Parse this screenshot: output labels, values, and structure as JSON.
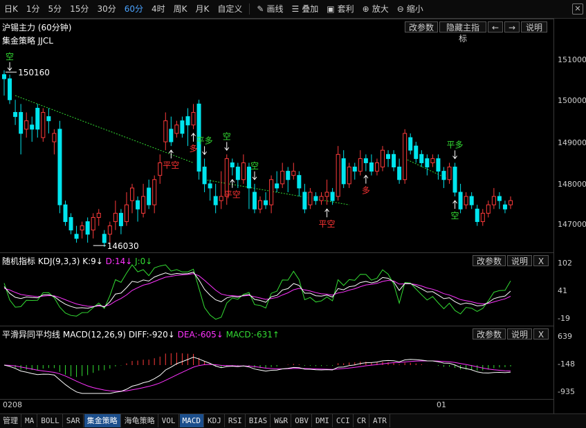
{
  "toolbar": {
    "periods": [
      {
        "label": "日K",
        "active": false
      },
      {
        "label": "1分",
        "active": false
      },
      {
        "label": "5分",
        "active": false
      },
      {
        "label": "15分",
        "active": false
      },
      {
        "label": "30分",
        "active": false
      },
      {
        "label": "60分",
        "active": true
      },
      {
        "label": "4时",
        "active": false
      },
      {
        "label": "周K",
        "active": false
      },
      {
        "label": "月K",
        "active": false
      },
      {
        "label": "自定义",
        "active": false
      }
    ],
    "tools": {
      "draw": "画线",
      "overlay": "叠加",
      "arbitrage": "套利",
      "zoom_in": "放大",
      "zoom_out": "缩小"
    }
  },
  "main": {
    "title": "沪锡主力 (60分钟)",
    "strategy": "集金策略 JJCL",
    "buttons": {
      "params": "改参数",
      "hide": "隐藏主指标",
      "prev": "←",
      "next": "→",
      "help": "说明"
    },
    "y_labels": [
      "151000",
      "150000",
      "149000",
      "148000",
      "147000"
    ],
    "high_label": "150160",
    "low_label": "146030",
    "signals": [
      {
        "text": "空",
        "type": "sell"
      },
      {
        "text": "平多",
        "type": "sell"
      },
      {
        "text": "多",
        "type": "buy"
      },
      {
        "text": "空",
        "type": "sell"
      },
      {
        "text": "空",
        "type": "sell"
      },
      {
        "text": "平空",
        "type": "buy"
      },
      {
        "text": "平空",
        "type": "buy"
      },
      {
        "text": "多",
        "type": "buy"
      },
      {
        "text": "平空",
        "type": "buy"
      },
      {
        "text": "平多",
        "type": "sell"
      },
      {
        "text": "空",
        "type": "sell"
      }
    ]
  },
  "kdj": {
    "name": "随机指标",
    "params": "KDJ(9,3,3)",
    "k": "K:9↓",
    "d": "D:14↓",
    "j": "J:0↓",
    "buttons": {
      "params": "改参数",
      "help": "说明",
      "close": "X"
    },
    "y_labels": [
      "102",
      "41",
      "-19"
    ]
  },
  "macd": {
    "name": "平滑异同平均线",
    "params": "MACD(12,26,9)",
    "diff": "DIFF:-920↓",
    "dea": "DEA:-605↓",
    "macd": "MACD:-631↑",
    "buttons": {
      "params": "改参数",
      "help": "说明",
      "close": "X"
    },
    "y_labels": [
      "639",
      "-148",
      "-935"
    ]
  },
  "time_axis": {
    "start": "0208",
    "mid": "01"
  },
  "bottom_tabs": [
    {
      "label": "管理",
      "active": false
    },
    {
      "label": "MA",
      "active": false
    },
    {
      "label": "BOLL",
      "active": false
    },
    {
      "label": "SAR",
      "active": false
    },
    {
      "label": "集金策略",
      "active": true
    },
    {
      "label": "海龟策略",
      "active": false
    },
    {
      "label": "VOL",
      "active": false
    },
    {
      "label": "MACD",
      "active": true
    },
    {
      "label": "KDJ",
      "active": false
    },
    {
      "label": "RSI",
      "active": false
    },
    {
      "label": "BIAS",
      "active": false
    },
    {
      "label": "W&R",
      "active": false
    },
    {
      "label": "OBV",
      "active": false
    },
    {
      "label": "DMI",
      "active": false
    },
    {
      "label": "CCI",
      "active": false
    },
    {
      "label": "CR",
      "active": false
    },
    {
      "label": "ATR",
      "active": false
    }
  ],
  "colors": {
    "up": "#ff3b3b",
    "down": "#00e5ee",
    "k": "#ffffff",
    "d": "#ff33ff",
    "j": "#33dd33",
    "accent": "#4aa3ff",
    "signal_text_sell": "#33dd33",
    "signal_text_buy": "#ff3333"
  },
  "chart_data": {
    "type": "candlestick",
    "title": "沪锡主力 (60分钟)",
    "ylim": [
      146000,
      151200
    ],
    "candles": [
      [
        150100,
        150000,
        149600,
        150200
      ],
      [
        150000,
        149500,
        149400,
        150100
      ],
      [
        149200,
        149100,
        148900,
        149500
      ],
      [
        149200,
        148700,
        148200,
        149400
      ],
      [
        148800,
        149000,
        148600,
        149200
      ],
      [
        148900,
        148800,
        148500,
        149100
      ],
      [
        149300,
        148800,
        148600,
        149400
      ],
      [
        148600,
        149200,
        148500,
        149300
      ],
      [
        149100,
        149000,
        148700,
        149300
      ],
      [
        148500,
        148700,
        148200,
        148800
      ],
      [
        148800,
        147000,
        146800,
        149000
      ],
      [
        147000,
        146600,
        146500,
        147100
      ],
      [
        146700,
        146400,
        146300,
        146800
      ],
      [
        146300,
        146200,
        146100,
        146500
      ],
      [
        146400,
        146500,
        146200,
        146600
      ],
      [
        146600,
        146300,
        146100,
        146700
      ],
      [
        146400,
        146700,
        146200,
        146800
      ],
      [
        146700,
        146800,
        146500,
        146900
      ],
      [
        146300,
        146100,
        146000,
        146400
      ],
      [
        146300,
        146500,
        146100,
        146600
      ],
      [
        146600,
        146800,
        146400,
        147100
      ],
      [
        146800,
        146500,
        146300,
        146900
      ],
      [
        146600,
        147000,
        146500,
        147300
      ],
      [
        147100,
        147400,
        146800,
        147500
      ],
      [
        147100,
        146900,
        146600,
        147200
      ],
      [
        146800,
        147200,
        146700,
        147500
      ],
      [
        147400,
        147000,
        146900,
        147600
      ],
      [
        147000,
        147600,
        146800,
        147700
      ],
      [
        147700,
        148000,
        147500,
        148200
      ],
      [
        148500,
        149000,
        148300,
        149200
      ],
      [
        148800,
        148500,
        148400,
        149100
      ],
      [
        148700,
        148900,
        148600,
        149000
      ],
      [
        149000,
        148700,
        148600,
        149100
      ],
      [
        149100,
        148900,
        148400,
        149300
      ],
      [
        148900,
        149200,
        148800,
        149400
      ],
      [
        149400,
        147800,
        147600,
        149500
      ],
      [
        147900,
        147500,
        147300,
        148100
      ],
      [
        147500,
        147400,
        147100,
        147600
      ],
      [
        147200,
        147000,
        146800,
        147500
      ],
      [
        147100,
        147200,
        146900,
        147800
      ],
      [
        147200,
        148100,
        147000,
        148200
      ],
      [
        148000,
        147900,
        147700,
        148100
      ],
      [
        147900,
        147600,
        147400,
        148000
      ],
      [
        147600,
        148000,
        147500,
        148200
      ],
      [
        147900,
        147400,
        146900,
        148000
      ],
      [
        147300,
        146900,
        146800,
        147500
      ],
      [
        146900,
        147100,
        146800,
        147200
      ],
      [
        147100,
        147000,
        146900,
        147300
      ],
      [
        147000,
        147600,
        146800,
        147700
      ],
      [
        147500,
        147400,
        147300,
        147800
      ],
      [
        147500,
        147800,
        147400,
        148000
      ],
      [
        147800,
        147600,
        147300,
        147900
      ],
      [
        147700,
        147800,
        147600,
        148000
      ],
      [
        147700,
        147400,
        147200,
        147800
      ],
      [
        147300,
        146900,
        146800,
        147500
      ],
      [
        147000,
        147300,
        146900,
        147400
      ],
      [
        147200,
        147100,
        147000,
        147300
      ],
      [
        147100,
        147200,
        147000,
        147300
      ],
      [
        147200,
        147300,
        147000,
        147600
      ],
      [
        147300,
        147100,
        147000,
        147400
      ],
      [
        147200,
        148200,
        147100,
        148400
      ],
      [
        148100,
        147500,
        147400,
        148300
      ],
      [
        147500,
        147900,
        147400,
        148000
      ],
      [
        147900,
        147800,
        147600,
        148000
      ],
      [
        147800,
        148100,
        147700,
        148300
      ],
      [
        148100,
        148000,
        147800,
        148200
      ],
      [
        148000,
        147800,
        147700,
        148200
      ],
      [
        147800,
        148000,
        147700,
        148100
      ],
      [
        147900,
        148300,
        147800,
        148400
      ],
      [
        148200,
        148100,
        147900,
        148300
      ],
      [
        148200,
        147900,
        147800,
        148300
      ],
      [
        147900,
        147600,
        147500,
        148100
      ],
      [
        147600,
        148700,
        147500,
        148800
      ],
      [
        148600,
        148300,
        148200,
        148700
      ],
      [
        148400,
        148100,
        148000,
        148500
      ],
      [
        148200,
        148000,
        147900,
        148300
      ],
      [
        148100,
        147900,
        147700,
        148200
      ],
      [
        148000,
        148100,
        147900,
        148200
      ],
      [
        148100,
        147800,
        147600,
        148200
      ],
      [
        147800,
        147600,
        147400,
        147900
      ],
      [
        147600,
        147900,
        147500,
        148000
      ],
      [
        147900,
        147300,
        147200,
        148000
      ],
      [
        147300,
        146900,
        146800,
        147500
      ],
      [
        147000,
        147200,
        146900,
        147300
      ],
      [
        147200,
        147000,
        146900,
        147300
      ],
      [
        146900,
        146600,
        146500,
        147000
      ],
      [
        146600,
        146800,
        146500,
        146900
      ],
      [
        146800,
        147000,
        146700,
        147100
      ],
      [
        147000,
        147200,
        146900,
        147400
      ],
      [
        147200,
        147100,
        146900,
        147300
      ],
      [
        147000,
        146900,
        146800,
        147100
      ],
      [
        147000,
        147100,
        146900,
        147200
      ]
    ]
  }
}
